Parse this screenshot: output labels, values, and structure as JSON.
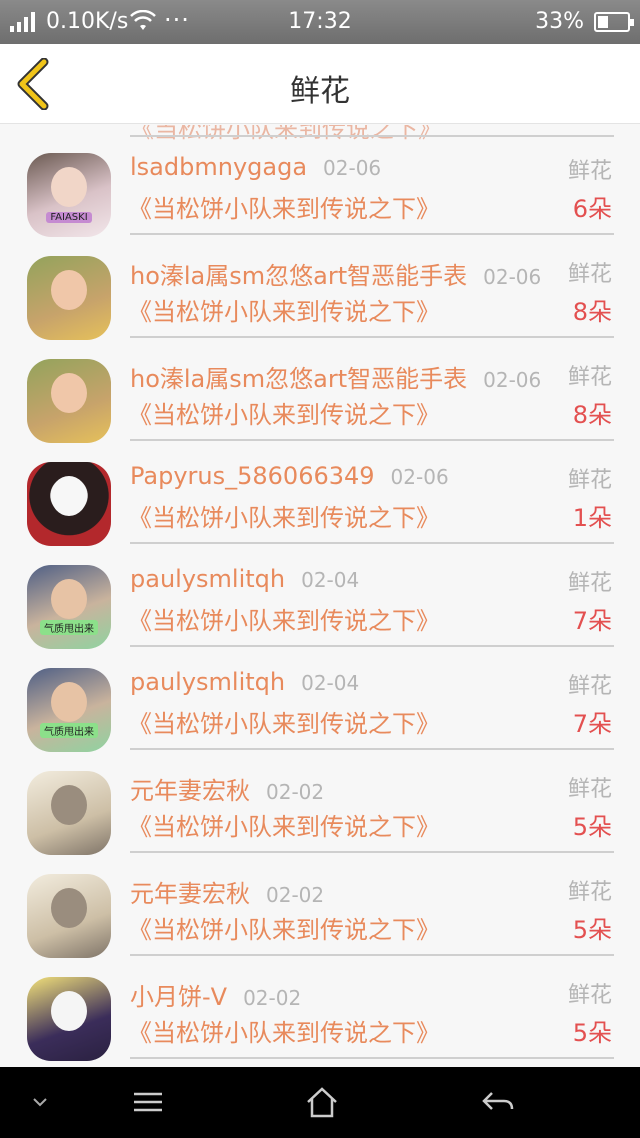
{
  "status_bar": {
    "network_speed": "0.10K/s",
    "overflow": "···",
    "time": "17:32",
    "battery_percent": "33%",
    "battery_level": 0.33,
    "icons": [
      "signal-icon",
      "wifi-icon",
      "battery-icon"
    ]
  },
  "header": {
    "title": "鲜花",
    "back_icon": "chevron-left-icon"
  },
  "partial_row": {
    "work": "《当松饼小队来到传说之下》"
  },
  "rows": [
    {
      "name": "lsadbmnygaga",
      "date": "02-06",
      "kind": "鲜花",
      "work": "《当松饼小队来到传说之下》",
      "count": "6朵",
      "avatar_tag": "FAIASKI"
    },
    {
      "name": "ho溱la属sm忽悠art智恶能手表",
      "date": "02-06",
      "kind": "鲜花",
      "work": "《当松饼小队来到传说之下》",
      "count": "8朵",
      "avatar_tag": ""
    },
    {
      "name": "ho溱la属sm忽悠art智恶能手表",
      "date": "02-06",
      "kind": "鲜花",
      "work": "《当松饼小队来到传说之下》",
      "count": "8朵",
      "avatar_tag": ""
    },
    {
      "name": "Papyrus_586066349",
      "date": "02-06",
      "kind": "鲜花",
      "work": "《当松饼小队来到传说之下》",
      "count": "1朵",
      "avatar_tag": ""
    },
    {
      "name": "paulysmlitqh",
      "date": "02-04",
      "kind": "鲜花",
      "work": "《当松饼小队来到传说之下》",
      "count": "7朵",
      "avatar_tag": "气质甩出来"
    },
    {
      "name": "paulysmlitqh",
      "date": "02-04",
      "kind": "鲜花",
      "work": "《当松饼小队来到传说之下》",
      "count": "7朵",
      "avatar_tag": "气质甩出来"
    },
    {
      "name": "元年妻宏秋",
      "date": "02-02",
      "kind": "鲜花",
      "work": "《当松饼小队来到传说之下》",
      "count": "5朵",
      "avatar_tag": ""
    },
    {
      "name": "元年妻宏秋",
      "date": "02-02",
      "kind": "鲜花",
      "work": "《当松饼小队来到传说之下》",
      "count": "5朵",
      "avatar_tag": ""
    },
    {
      "name": "小月饼-V",
      "date": "02-02",
      "kind": "鲜花",
      "work": "《当松饼小队来到传说之下》",
      "count": "5朵",
      "avatar_tag": ""
    }
  ],
  "navbar": {
    "icons": [
      "chevron-down-icon",
      "menu-icon",
      "home-icon",
      "back-arrow-icon"
    ]
  },
  "colors": {
    "accent_name": "#e88a5c",
    "count_red": "#e35050",
    "back_arrow": "#f0c419"
  }
}
